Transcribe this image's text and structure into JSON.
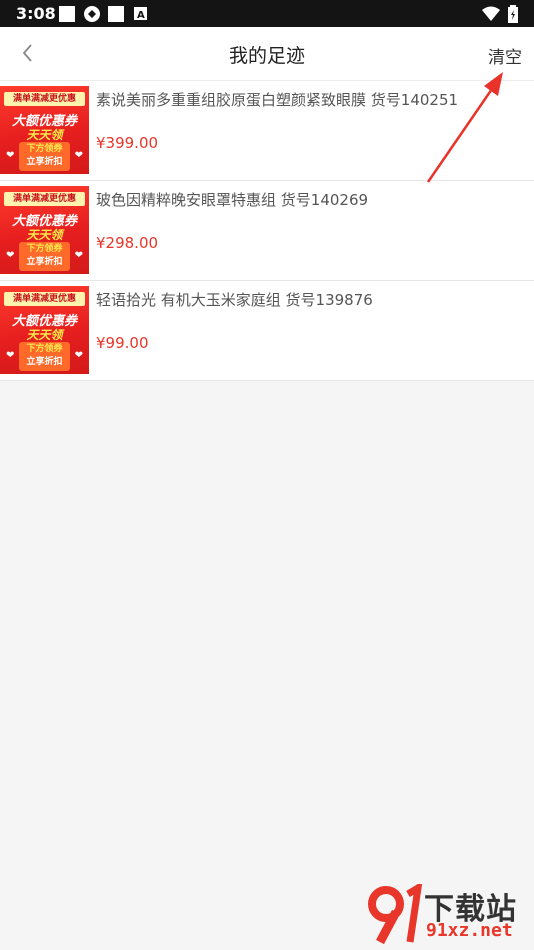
{
  "status_bar": {
    "time": "3:08"
  },
  "header": {
    "title": "我的足迹",
    "clear_label": "清空"
  },
  "promo_badge": {
    "line1": "满单满减更优惠",
    "line2": "大额优惠券",
    "line3": "天天领",
    "line4": "下方领券",
    "line5": "立享折扣"
  },
  "items": [
    {
      "name": "素说美丽多重重组胶原蛋白塑颜紧致眼膜 货号140251",
      "price": "¥399.00"
    },
    {
      "name": "玻色因精粹晚安眼罩特惠组 货号140269",
      "price": "¥298.00"
    },
    {
      "name": "轻语拾光 有机大玉米家庭组 货号139876",
      "price": "¥99.00"
    }
  ],
  "watermark": {
    "brand": "下载站",
    "url": "91xz.net"
  },
  "colors": {
    "price": "#e8362a",
    "annotation_arrow": "#e8322a"
  }
}
